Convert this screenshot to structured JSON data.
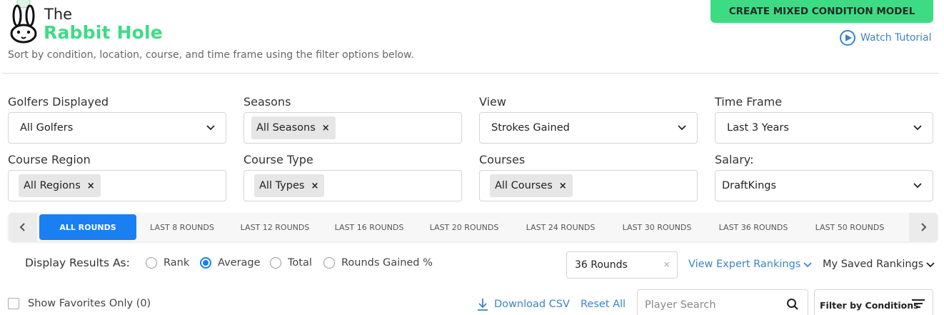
{
  "brand": {
    "line1": "The",
    "line2": "Rabbit Hole",
    "accent": "#3ddc84"
  },
  "subtitle": "Sort by condition, location, course, and time frame using the filter options below.",
  "header": {
    "create_button": "CREATE MIXED CONDITION MODEL",
    "watch_tutorial": "Watch Tutorial",
    "link_color": "#3a84c9"
  },
  "filters": {
    "golfers": {
      "label": "Golfers Displayed",
      "value": "All Golfers",
      "icon": "chevron-down-icon"
    },
    "seasons": {
      "label": "Seasons",
      "chip": "All Seasons"
    },
    "view": {
      "label": "View",
      "value": "Strokes Gained",
      "icon": "chevron-down-icon"
    },
    "timeframe": {
      "label": "Time Frame",
      "value": "Last 3 Years",
      "icon": "chevron-down-icon"
    },
    "region": {
      "label": "Course Region",
      "chip": "All Regions"
    },
    "type": {
      "label": "Course Type",
      "chip": "All Types"
    },
    "courses": {
      "label": "Courses",
      "chip": "All Courses"
    },
    "salary": {
      "label": "Salary:",
      "value": "DraftKings",
      "icon": "chevron-down-icon"
    },
    "chip_remove": "×"
  },
  "rounds_tabs": {
    "active_color": "#1a7ff2",
    "items": [
      "ALL ROUNDS",
      "LAST 8 ROUNDS",
      "LAST 12 ROUNDS",
      "LAST 16 ROUNDS",
      "LAST 20 ROUNDS",
      "LAST 24 ROUNDS",
      "LAST 30 ROUNDS",
      "LAST 36 ROUNDS",
      "LAST 50 ROUNDS"
    ],
    "active_index": 0
  },
  "display": {
    "label": "Display Results As:",
    "options": [
      "Rank",
      "Average",
      "Total",
      "Rounds Gained %"
    ],
    "selected": "Average"
  },
  "rounds_select": {
    "value": "36 Rounds",
    "clear": "×"
  },
  "expert_rankings": "View Expert Rankings",
  "saved_rankings": "My Saved Rankings",
  "favorites": "Show Favorites Only (0)",
  "download_csv": "Download CSV",
  "reset_all": "Reset All",
  "player_search": {
    "placeholder": "Player Search"
  },
  "filter_conditions": "Filter by Conditions"
}
